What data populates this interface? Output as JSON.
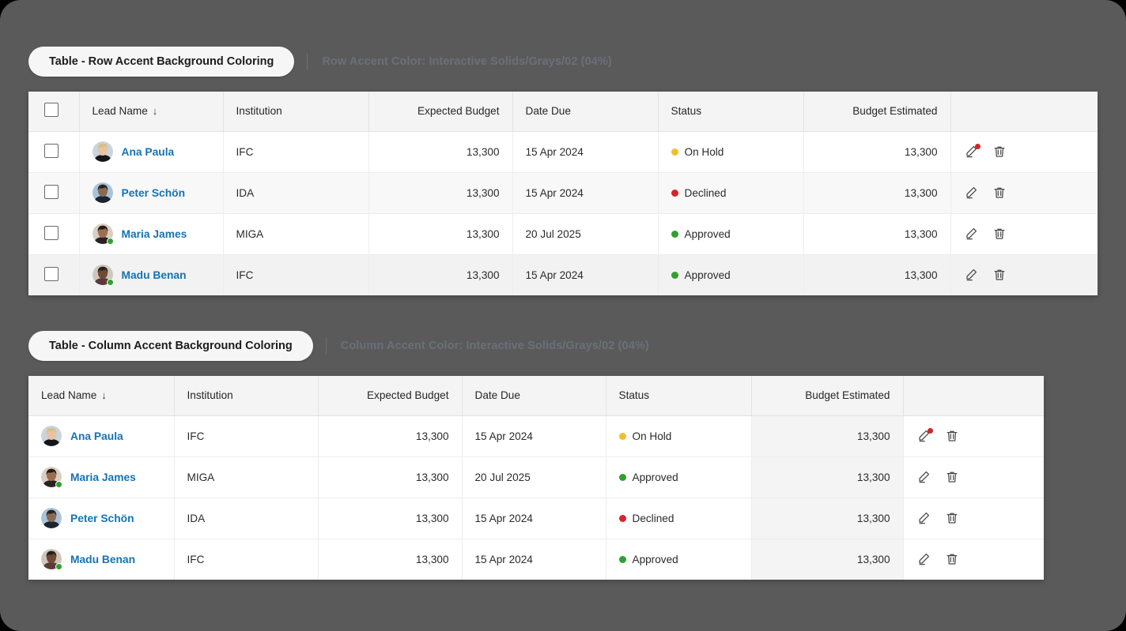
{
  "theme": {
    "page_background": "#000000",
    "stage_background": "#5a5a5a",
    "card_background": "#ffffff",
    "header_background": "#f4f4f4",
    "link_color": "#1473b5",
    "accent_background": "#f4f4f4",
    "status_colors": {
      "on_hold": "#f0c02c",
      "declined": "#d8232a",
      "approved": "#2fa02f"
    },
    "presence_online": "#2fa02f",
    "badge_color": "#d8232a"
  },
  "sections": [
    {
      "id": "row-accent",
      "chip_label": "Table - Row Accent Background Coloring",
      "note": "Row Accent Color: Interactive Solids/Grays/02 (04%)"
    },
    {
      "id": "column-accent",
      "chip_label": "Table - Column Accent Background Coloring",
      "note": "Column Accent Color: Interactive Solids/Grays/02 (04%)"
    }
  ],
  "table_row_accent": {
    "has_checkbox_column": true,
    "select_all_checked": false,
    "columns": [
      {
        "key": "select",
        "label": "",
        "align": "left"
      },
      {
        "key": "lead_name",
        "label": "Lead Name",
        "align": "left",
        "sorted": true,
        "sort_direction": "desc",
        "sort_glyph": "↓"
      },
      {
        "key": "institution",
        "label": "Institution",
        "align": "left"
      },
      {
        "key": "expected_budget",
        "label": "Expected Budget",
        "align": "right"
      },
      {
        "key": "date_due",
        "label": "Date Due",
        "align": "left"
      },
      {
        "key": "status",
        "label": "Status",
        "align": "left"
      },
      {
        "key": "budget_estimated",
        "label": "Budget Estimated",
        "align": "right"
      },
      {
        "key": "actions",
        "label": "",
        "align": "left"
      }
    ],
    "rows": [
      {
        "checked": false,
        "lead_name": "Ana Paula",
        "avatar_name": "avatar-ana-paula",
        "presence": "none",
        "institution": "IFC",
        "expected_budget": "13,300",
        "date_due": "15 Apr 2024",
        "status": "On Hold",
        "status_key": "on_hold",
        "budget_estimated": "13,300",
        "edit_badge": true,
        "row_accent": false
      },
      {
        "checked": false,
        "lead_name": "Peter Schön",
        "avatar_name": "avatar-peter-schon",
        "presence": "none",
        "institution": "IDA",
        "expected_budget": "13,300",
        "date_due": "15 Apr 2024",
        "status": "Declined",
        "status_key": "declined",
        "budget_estimated": "13,300",
        "edit_badge": false,
        "row_accent": true
      },
      {
        "checked": false,
        "lead_name": "Maria James",
        "avatar_name": "avatar-maria-james",
        "presence": "online",
        "institution": "MIGA",
        "expected_budget": "13,300",
        "date_due": "20 Jul 2025",
        "status": "Approved",
        "status_key": "approved",
        "budget_estimated": "13,300",
        "edit_badge": false,
        "row_accent": false
      },
      {
        "checked": false,
        "lead_name": "Madu Benan",
        "avatar_name": "avatar-madu-benan",
        "presence": "online",
        "institution": "IFC",
        "expected_budget": "13,300",
        "date_due": "15 Apr 2024",
        "status": "Approved",
        "status_key": "approved",
        "budget_estimated": "13,300",
        "edit_badge": false,
        "row_accent": true
      }
    ]
  },
  "table_column_accent": {
    "has_checkbox_column": false,
    "accent_column_key": "budget_estimated",
    "columns": [
      {
        "key": "lead_name",
        "label": "Lead Name",
        "align": "left",
        "sorted": true,
        "sort_direction": "desc",
        "sort_glyph": "↓"
      },
      {
        "key": "institution",
        "label": "Institution",
        "align": "left"
      },
      {
        "key": "expected_budget",
        "label": "Expected Budget",
        "align": "right"
      },
      {
        "key": "date_due",
        "label": "Date Due",
        "align": "left"
      },
      {
        "key": "status",
        "label": "Status",
        "align": "left"
      },
      {
        "key": "budget_estimated",
        "label": "Budget Estimated",
        "align": "right"
      },
      {
        "key": "actions",
        "label": "",
        "align": "left"
      }
    ],
    "rows": [
      {
        "lead_name": "Ana Paula",
        "avatar_name": "avatar-ana-paula",
        "presence": "none",
        "institution": "IFC",
        "expected_budget": "13,300",
        "date_due": "15 Apr 2024",
        "status": "On Hold",
        "status_key": "on_hold",
        "budget_estimated": "13,300",
        "edit_badge": true
      },
      {
        "lead_name": "Maria James",
        "avatar_name": "avatar-maria-james",
        "presence": "online",
        "institution": "MIGA",
        "expected_budget": "13,300",
        "date_due": "20 Jul 2025",
        "status": "Approved",
        "status_key": "approved",
        "budget_estimated": "13,300",
        "edit_badge": false
      },
      {
        "lead_name": "Peter Schön",
        "avatar_name": "avatar-peter-schon",
        "presence": "none",
        "institution": "IDA",
        "expected_budget": "13,300",
        "date_due": "15 Apr 2024",
        "status": "Declined",
        "status_key": "declined",
        "budget_estimated": "13,300",
        "edit_badge": false
      },
      {
        "lead_name": "Madu Benan",
        "avatar_name": "avatar-madu-benan",
        "presence": "online",
        "institution": "IFC",
        "expected_budget": "13,300",
        "date_due": "15 Apr 2024",
        "status": "Approved",
        "status_key": "approved",
        "budget_estimated": "13,300",
        "edit_badge": false
      }
    ]
  },
  "icons": {
    "edit": "pencil-icon",
    "delete": "trash-icon",
    "sort": "sort-desc-icon",
    "checkbox": "checkbox-icon"
  }
}
